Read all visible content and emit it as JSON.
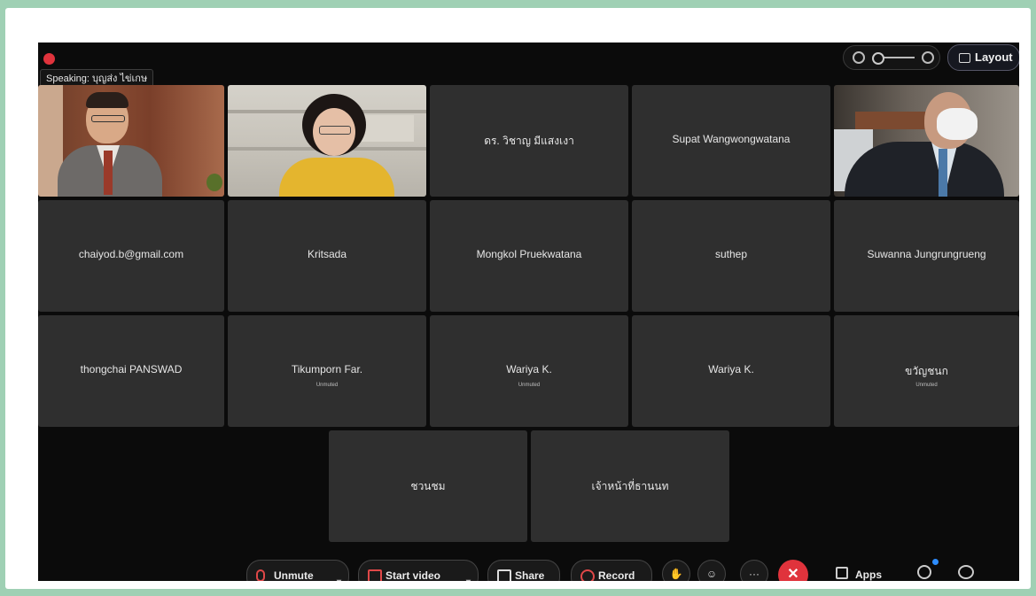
{
  "meeting": {
    "speaking_label": "Speaking: บุญส่ง ไข่เกษ",
    "layout_button": "Layout"
  },
  "tiles": [
    {
      "id": "video-1",
      "kind": "video",
      "name": ""
    },
    {
      "id": "video-2",
      "kind": "video",
      "name": ""
    },
    {
      "id": "tile-3",
      "kind": "name",
      "name": "ดร. วิชาญ มีแสงเงา"
    },
    {
      "id": "tile-4",
      "kind": "name",
      "name": "Supat Wangwongwatana"
    },
    {
      "id": "video-5",
      "kind": "video",
      "name": ""
    },
    {
      "id": "tile-6",
      "kind": "name",
      "name": "chaiyod.b@gmail.com"
    },
    {
      "id": "tile-7",
      "kind": "name",
      "name": "Kritsada"
    },
    {
      "id": "tile-8",
      "kind": "name",
      "name": "Mongkol Pruekwatana"
    },
    {
      "id": "tile-9",
      "kind": "name",
      "name": "suthep"
    },
    {
      "id": "tile-10",
      "kind": "name",
      "name": "Suwanna Jungrungrueng"
    },
    {
      "id": "tile-11",
      "kind": "name",
      "name": "thongchai PANSWAD"
    },
    {
      "id": "tile-12",
      "kind": "name",
      "name": "Tikumporn Far.",
      "sub": "Unmuted"
    },
    {
      "id": "tile-13",
      "kind": "name",
      "name": "Wariya K.",
      "sub": "Unmuted"
    },
    {
      "id": "tile-14",
      "kind": "name",
      "name": "Wariya K."
    },
    {
      "id": "tile-15",
      "kind": "name",
      "name": "ขวัญชนก",
      "sub": "Unmuted"
    },
    {
      "id": "tile-16",
      "kind": "name",
      "name": "ชวนชม"
    },
    {
      "id": "tile-17",
      "kind": "name",
      "name": "เจ้าหน้าที่ธานนท"
    }
  ],
  "toolbar": {
    "unmute": "Unmute",
    "start_video": "Start video",
    "share": "Share",
    "record": "Record",
    "apps": "Apps",
    "end_symbol": "✕",
    "more_symbol": "···"
  },
  "colors": {
    "tile_bg": "#2f2f2f",
    "screen_bg": "#0b0b0b",
    "end_call": "#e0333c",
    "accent_blue": "#2d8cff"
  }
}
